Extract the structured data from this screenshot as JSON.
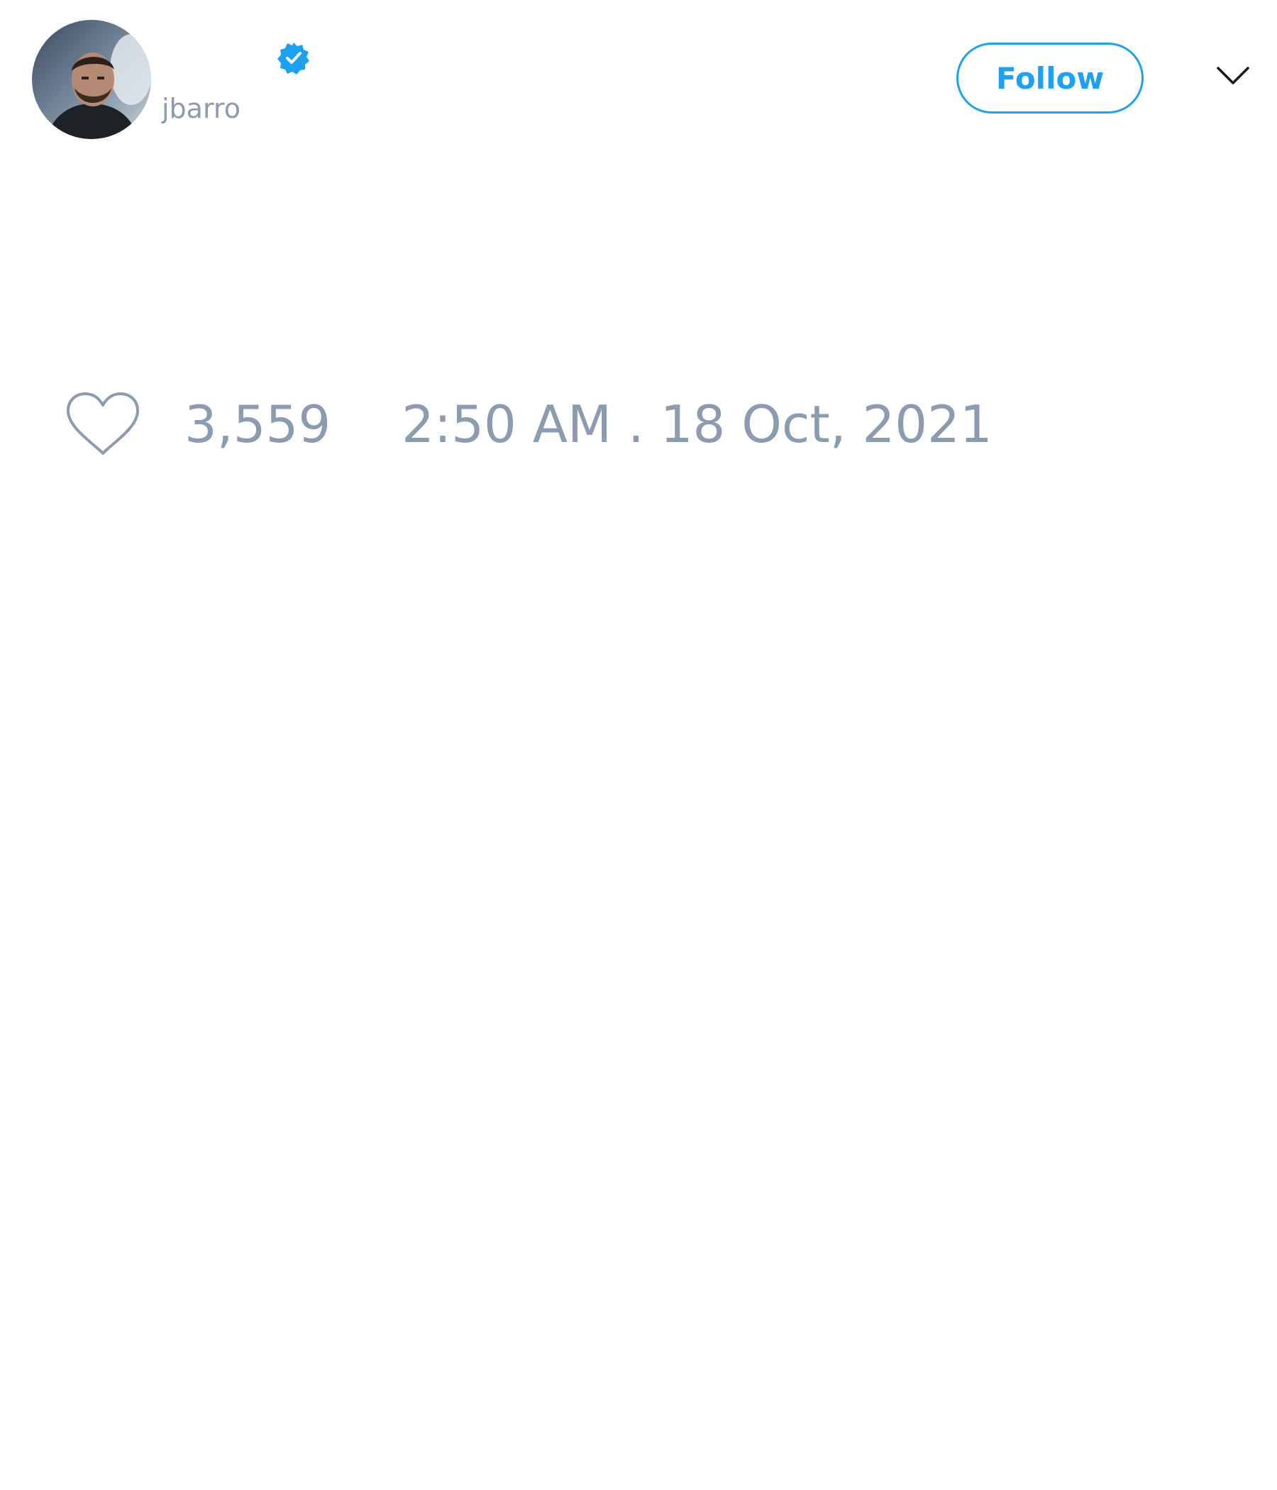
{
  "author": {
    "handle": "jbarro",
    "verified": true
  },
  "header": {
    "follow_label": "Follow",
    "menu_icon": "chevron-down-icon"
  },
  "tweet": {
    "like_icon": "heart-icon",
    "like_count": "3,559",
    "timestamp": "2:50 AM . 18 Oct, 2021"
  },
  "colors": {
    "accent": "#1da1f2",
    "muted_text": "#8b9bb0"
  }
}
